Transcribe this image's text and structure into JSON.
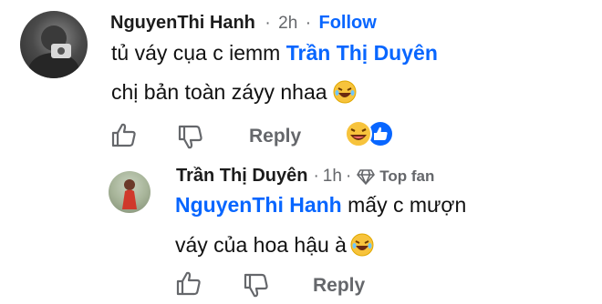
{
  "comments": [
    {
      "author": "NguyenThi Hanh",
      "sep1": "·",
      "time": "2h",
      "sep2": "·",
      "follow_label": "Follow",
      "line1_prefix": "tủ váy cụa c iemm ",
      "line1_mention": "Trần Thị Duyên",
      "line2_text": "chị bản toàn záyy nhaa",
      "line2_emoji": "laughing-face",
      "reply_label": "Reply",
      "reactions": [
        "laughing-face",
        "like"
      ],
      "avatar": "profile-photo"
    },
    {
      "author": "Trần Thị Duyên",
      "sep1": "·",
      "time": "1h",
      "sep2": "·",
      "badge_label": "Top fan",
      "badge_icon": "diamond",
      "line1_mention": "NguyenThi Hanh",
      "line1_suffix": " mấy c mượn",
      "line2_text": "váy của hoa hậu à",
      "line2_emoji": "laughing-face",
      "reply_label": "Reply",
      "avatar": "profile-photo"
    }
  ],
  "colors": {
    "link_blue": "#0866ff",
    "meta_gray": "#65676b",
    "emoji_yellow": "#f7c33c"
  }
}
